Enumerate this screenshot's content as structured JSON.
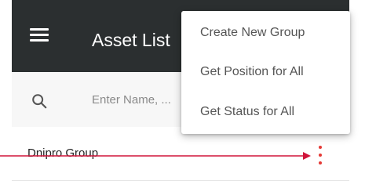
{
  "app_bar": {
    "title": "Asset List",
    "background": "#2b2f30",
    "menu_icon": "hamburger-menu-icon"
  },
  "search": {
    "placeholder": "Enter Name, ...",
    "icon": "search-icon"
  },
  "groups": [
    {
      "name": "Dnipro Group",
      "menu_icon": "more-vert-icon"
    }
  ],
  "overflow_menu": {
    "items": [
      {
        "label": "Create New Group"
      },
      {
        "label": "Get Position for All"
      },
      {
        "label": "Get Status for All"
      }
    ]
  },
  "annotation": {
    "color": "#d0153a",
    "points_to": "group-options-button"
  }
}
